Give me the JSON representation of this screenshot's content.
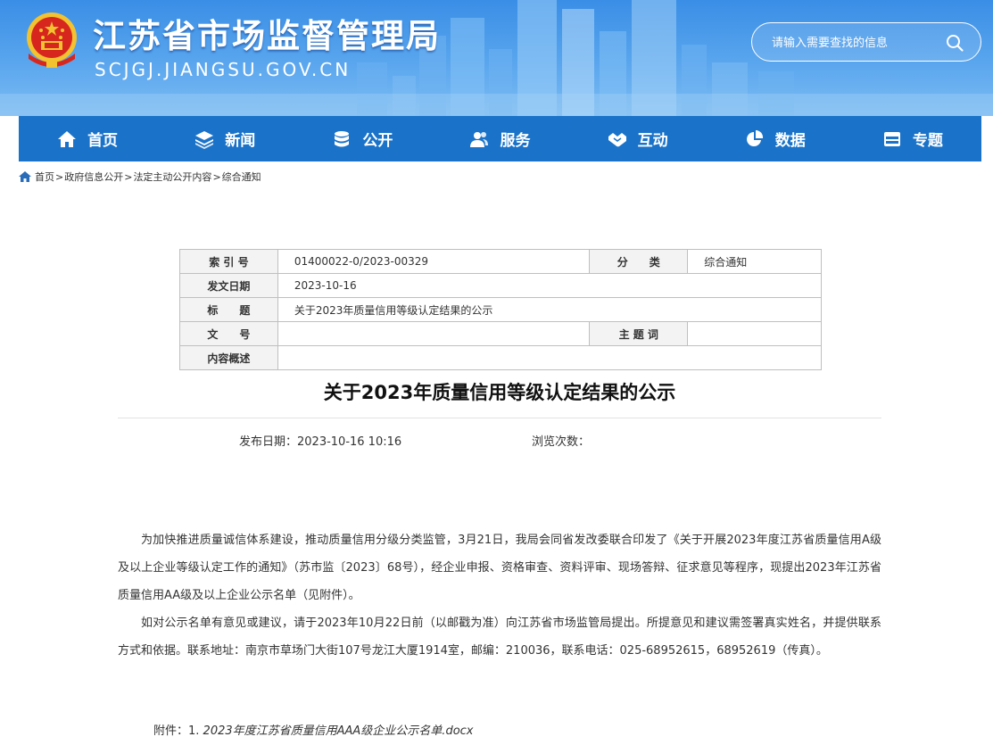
{
  "header": {
    "site_title": "江苏省市场监督管理局",
    "site_url": "SCJGJ.JIANGSU.GOV.CN",
    "search_placeholder": "请输入需要查找的信息"
  },
  "nav": {
    "items": [
      {
        "label": "首页",
        "icon": "home-icon"
      },
      {
        "label": "新闻",
        "icon": "layers-icon"
      },
      {
        "label": "公开",
        "icon": "database-icon"
      },
      {
        "label": "服务",
        "icon": "users-icon"
      },
      {
        "label": "互动",
        "icon": "handshake-icon"
      },
      {
        "label": "数据",
        "icon": "pie-chart-icon"
      },
      {
        "label": "专题",
        "icon": "window-icon"
      }
    ]
  },
  "breadcrumb": {
    "items": [
      "首页",
      "政府信息公开",
      "法定主动公开内容",
      "综合通知"
    ],
    "separator": ">"
  },
  "info_table": {
    "index_label": "索 引 号",
    "index_value": "01400022-0/2023-00329",
    "category_label": "分　　类",
    "category_value": "综合通知",
    "date_label": "发文日期",
    "date_value": "2023-10-16",
    "title_label": "标　　题",
    "title_value": "关于2023年质量信用等级认定结果的公示",
    "docno_label": "文　　号",
    "docno_value": "",
    "keyword_label": "主 题 词",
    "keyword_value": "",
    "summary_label": "内容概述",
    "summary_value": ""
  },
  "article": {
    "title": "关于2023年质量信用等级认定结果的公示",
    "publish_label": "发布日期：2023-10-16 10:16",
    "views_label": "浏览次数：",
    "paragraphs": [
      "为加快推进质量诚信体系建设，推动质量信用分级分类监管，3月21日，我局会同省发改委联合印发了《关于开展2023年度江苏省质量信用A级及以上企业等级认定工作的通知》（苏市监〔2023〕68号），经企业申报、资格审查、资料评审、现场答辩、征求意见等程序，现提出2023年江苏省质量信用AA级及以上企业公示名单（见附件）。",
      "如对公示名单有意见或建议，请于2023年10月22日前（以邮戳为准）向江苏省市场监管局提出。所提意见和建议需签署真实姓名，并提供联系方式和依据。联系地址：南京市草场门大街107号龙江大厦1914室，邮编：210036，联系电话：025-68952615，68952619（传真）。"
    ],
    "attachment_prefix": "附件：1. ",
    "attachment_file": "2023年度江苏省质量信用AAA级企业公示名单.docx"
  },
  "colors": {
    "header_blue": "#3a8ee6",
    "nav_blue": "#1a73c9",
    "emblem_red": "#d7261e",
    "emblem_gold": "#f2c230"
  }
}
